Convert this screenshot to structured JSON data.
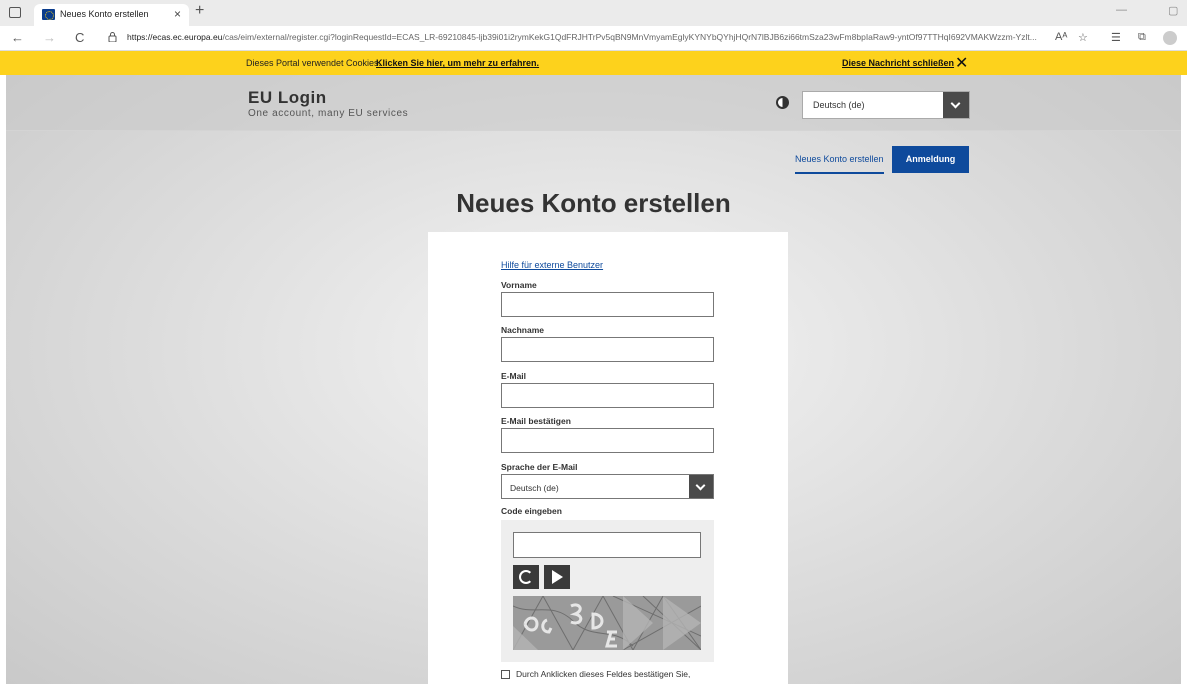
{
  "browser": {
    "tab_title": "Neues Konto erstellen",
    "tab_close": "×",
    "new_tab": "+",
    "url_domain": "https://ecas.ec.europa.eu",
    "url_path": "/cas/eim/external/register.cgi?loginRequestId=ECAS_LR-69210845-ljb39i01i2rymKekG1QdFRJHTrPv5qBN9MnVmyamEglyKYNYbQYhjHQrN7lBJB6zi66tmSza23wFm8bpIaRaw9-yntOf97TTHqI692VMAKWzzm-Yzlt...",
    "read_aloud": "Aᴬ",
    "back": "←",
    "forward": "→",
    "reload": "C",
    "minimize": "—",
    "restore": "▢"
  },
  "cookie_banner": {
    "text": "Dieses Portal verwendet Cookies.",
    "more_link": "Klicken Sie hier, um mehr zu erfahren.",
    "close_link": "Diese Nachricht schließen",
    "close_x": "✕"
  },
  "header": {
    "title": "EU Login",
    "subtitle": "One account, many EU services",
    "language_selected": "Deutsch (de)"
  },
  "nav": {
    "new_account": "Neues Konto erstellen",
    "login": "Anmeldung"
  },
  "page_title": "Neues Konto erstellen",
  "form": {
    "help_link": "Hilfe für externe Benutzer",
    "first_name_label": "Vorname",
    "last_name_label": "Nachname",
    "email_label": "E-Mail",
    "email_confirm_label": "E-Mail bestätigen",
    "email_language_label": "Sprache der E-Mail",
    "email_language_value": "Deutsch (de)",
    "code_label": "Code eingeben",
    "consent_text": "Durch Anklicken dieses Feldes bestätigen Sie,"
  },
  "colors": {
    "cookie_banner": "#fdd21c",
    "primary_blue": "#0e4a9c",
    "dark_button": "#4a4a4a"
  }
}
